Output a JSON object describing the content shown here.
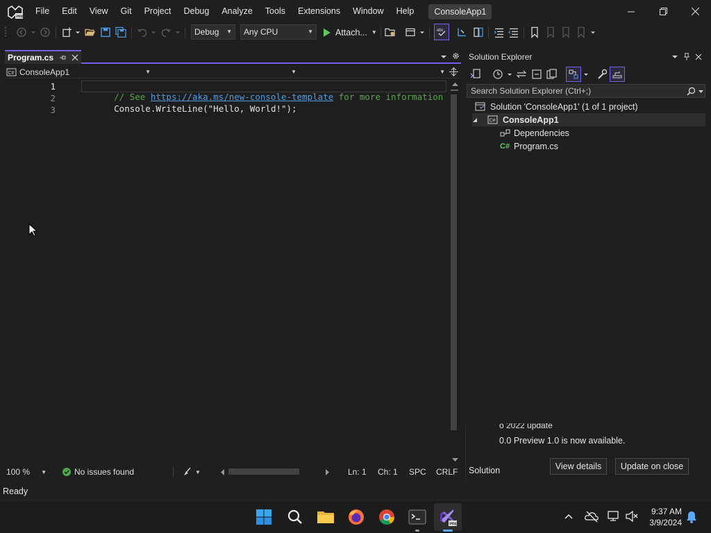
{
  "menu": {
    "items": [
      "File",
      "Edit",
      "View",
      "Git",
      "Project",
      "Debug",
      "Analyze",
      "Tools",
      "Extensions",
      "Window",
      "Help"
    ],
    "title": "ConsoleApp1"
  },
  "toolbar": {
    "config": "Debug",
    "platform": "Any CPU",
    "run_label": "Attach..."
  },
  "editor": {
    "tab_title": "Program.cs",
    "nav_project": "ConsoleApp1",
    "lines": [
      {
        "num": "1",
        "comment_prefix": "// See ",
        "link": "https://aka.ms/new-console-template",
        "comment_suffix": " for more information"
      },
      {
        "num": "2",
        "obj": "Console",
        "dot": ".",
        "method": "WriteLine",
        "open": "(",
        "string": "\"Hello, World!\"",
        "close": ");"
      },
      {
        "num": "3"
      }
    ],
    "status": {
      "zoom": "100 %",
      "issues": "No issues found",
      "line": "Ln: 1",
      "char": "Ch: 1",
      "spacing": "SPC",
      "eol": "CRLF"
    }
  },
  "solution_explorer": {
    "title": "Solution Explorer",
    "search_placeholder": "Search Solution Explorer (Ctrl+;)",
    "solution": "Solution 'ConsoleApp1' (1 of 1 project)",
    "project": "ConsoleApp1",
    "dependencies": "Dependencies",
    "file": "Program.cs",
    "bottom_tab": "Solution"
  },
  "notification": {
    "line1": "o 2022 update",
    "line2": "0.0 Preview 1.0 is now available.",
    "view_details": "View details",
    "update_on_close": "Update on close"
  },
  "statusbar": {
    "text": "Ready"
  },
  "clock": {
    "time": "9:37 AM",
    "date": "3/9/2024"
  },
  "colors": {
    "accent": "#7160e8",
    "comment": "#57a64a",
    "link": "#4e9ce6",
    "string": "#d69d85",
    "method": "#dcdcaa",
    "type": "#4ec9b0"
  }
}
